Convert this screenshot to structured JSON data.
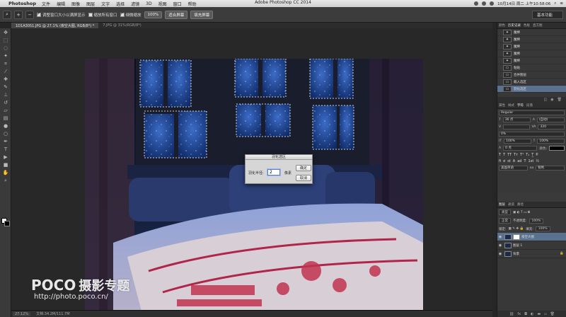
{
  "menubar": {
    "app_name": "Photoshop",
    "items": [
      "文件",
      "编辑",
      "图像",
      "图层",
      "文字",
      "选择",
      "滤镜",
      "3D",
      "视图",
      "窗口",
      "帮助"
    ],
    "clock": "10月14日 周二 上午10:58:06"
  },
  "window_title": "Adobe Photoshop CC 2014",
  "options": {
    "check1": "调整窗口大小以满屏显示",
    "check2": "缩放所有窗口",
    "check3": "细微缩放",
    "btn_100": "100%",
    "btn_fit": "适合屏幕",
    "btn_fill": "填充屏幕",
    "workspace": "基本功能"
  },
  "tabs": [
    {
      "label": "1D1A3051.JPG @ 27.1% (夜空大图, RGB/8*) *"
    },
    {
      "label": "7.JPG @ 31%(RGB/8*)"
    }
  ],
  "status": {
    "zoom": "27.12%",
    "doc": "文档:34.2M/111.7M"
  },
  "watermark": {
    "logo": "POCO",
    "cn": "摄影专题",
    "url": "http://photo.poco.cn/"
  },
  "dialog": {
    "title": "羽化选区",
    "label": "羽化半径:",
    "value": "2",
    "unit": "像素",
    "ok": "确定",
    "cancel": "取消"
  },
  "history": {
    "tabs": [
      "颜色",
      "历史记录",
      "色板",
      "直方图"
    ],
    "items": [
      "魔棒",
      "魔棒",
      "魔棒",
      "魔棒",
      "魔棒",
      "粘贴",
      "合并图层",
      "载入选区",
      "羽化选区"
    ]
  },
  "character": {
    "tabs": [
      "属性",
      "样式",
      "字符",
      "段落"
    ],
    "font_style": "Regular",
    "size": "36 点",
    "leading": "(自动)",
    "tracking": "320",
    "scale_v": "100%",
    "scale_h": "100%",
    "baseline": "0 点",
    "color_label": "颜色:",
    "kerning": "0%",
    "language": "美国英语",
    "aa": "aa",
    "aa_mode": "锐利"
  },
  "layers": {
    "tabs": [
      "图层",
      "通道",
      "路径"
    ],
    "kind": "类型",
    "blend": "正常",
    "opacity_label": "不透明度:",
    "opacity": "100%",
    "lock_label": "锁定:",
    "fill_label": "填充:",
    "fill": "100%",
    "items": [
      {
        "name": "夜空大图"
      },
      {
        "name": "图层 1"
      },
      {
        "name": "背景"
      }
    ]
  }
}
